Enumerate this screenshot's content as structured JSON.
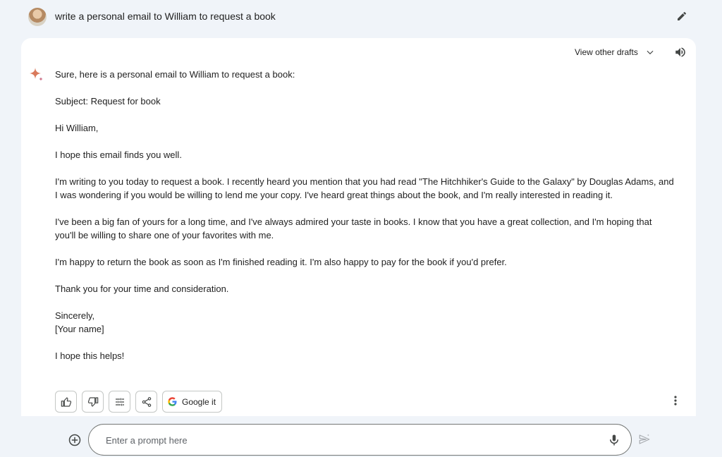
{
  "query": {
    "text": "write a personal email to William to request a book"
  },
  "drafts": {
    "label": "View other drafts"
  },
  "response": {
    "paragraphs": [
      "Sure, here is a personal email to William to request a book:",
      "Subject: Request for book",
      "Hi William,",
      "I hope this email finds you well.",
      "I'm writing to you today to request a book. I recently heard you mention that you had read \"The Hitchhiker's Guide to the Galaxy\" by Douglas Adams, and\nI was wondering if you would be willing to lend me your copy. I've heard great things about the book, and I'm really interested in reading it.",
      "I've been a big fan of yours for a long time, and I've always admired your taste in books. I know that you have a great collection, and I'm hoping that\nyou'll be willing to share one of your favorites with me.",
      "I'm happy to return the book as soon as I'm finished reading it. I'm also happy to pay for the book if you'd prefer.",
      "Thank you for your time and consideration.",
      "Sincerely,\n[Your name]",
      "I hope this helps!"
    ]
  },
  "actions": {
    "google_label": "Google it"
  },
  "input": {
    "placeholder": "Enter a prompt here",
    "value": ""
  },
  "icons": {
    "edit": "pencil-icon",
    "speaker": "volume-icon",
    "sparkle": "sparkle-icon",
    "thumbs_up": "thumbs-up-icon",
    "thumbs_down": "thumbs-down-icon",
    "modify": "sliders-icon",
    "share": "share-icon",
    "google": "google-g-icon",
    "more": "more-vertical-icon",
    "add": "add-circle-icon",
    "mic": "mic-icon",
    "send": "send-icon"
  },
  "colors": {
    "page_background": "#f0f4f9",
    "card_background": "#ffffff",
    "text": "#1f1f1f",
    "icon": "#444746",
    "border": "#c4c7c5"
  }
}
